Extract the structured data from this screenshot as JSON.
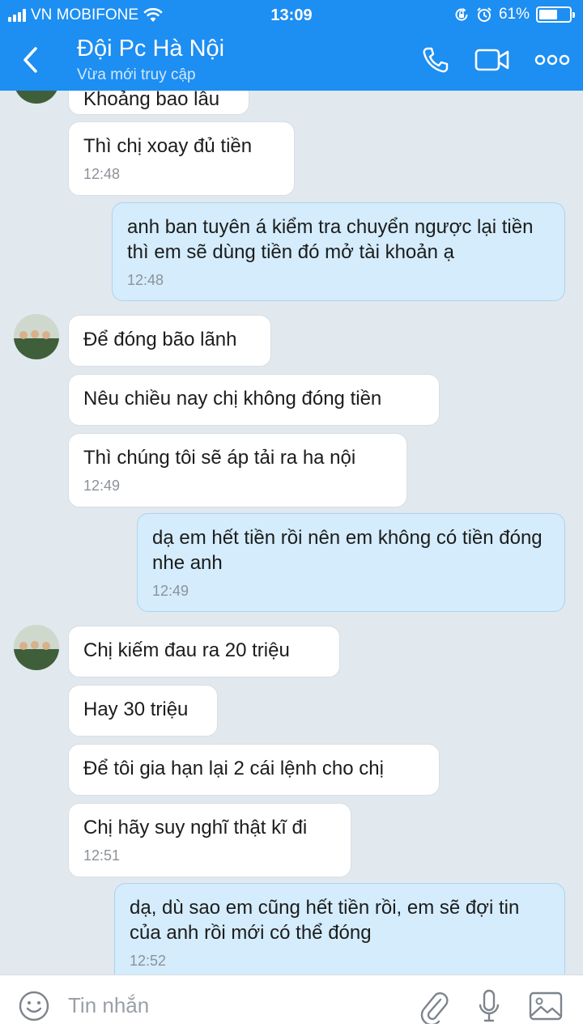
{
  "status_bar": {
    "carrier": "VN MOBIFONE",
    "time": "13:09",
    "battery": "61%",
    "battery_level": 0.61
  },
  "header": {
    "title": "Đội  Pc Hà Nội",
    "subtitle": "Vừa mới truy cập",
    "icons": [
      "back-arrow-icon",
      "phone-icon",
      "video-call-icon",
      "more-icon"
    ],
    "color": "#1d8ef2"
  },
  "messages": [
    {
      "side": "in",
      "text": "Khoảng bao lâu",
      "time": ""
    },
    {
      "side": "in",
      "text": "Thì chị xoay đủ tiền",
      "time": "12:48"
    },
    {
      "side": "out",
      "text": "anh ban tuyên á kiểm tra chuyển ngược lại tiền thì em sẽ dùng tiền đó mở tài khoản ạ",
      "time": "12:48"
    },
    {
      "side": "in",
      "text": "Để đóng bão lãnh",
      "time": ""
    },
    {
      "side": "in",
      "text": "Nêu chiều nay chị không đóng tiền",
      "time": ""
    },
    {
      "side": "in",
      "text": "Thì chúng tôi sẽ áp tải ra ha nội",
      "time": "12:49"
    },
    {
      "side": "out",
      "text": "dạ em hết tiền rồi nên em không có tiền đóng nhe anh",
      "time": "12:49"
    },
    {
      "side": "in",
      "text": "Chị kiếm đau ra 20 triệu",
      "time": ""
    },
    {
      "side": "in",
      "text": "Hay 30 triệu",
      "time": ""
    },
    {
      "side": "in",
      "text": "Để tôi gia hạn lại 2 cái lệnh cho chị",
      "time": ""
    },
    {
      "side": "in",
      "text": "Chị hãy suy nghĩ thật kĩ đi",
      "time": "12:51"
    },
    {
      "side": "out",
      "text": "dạ, dù sao em cũng hết tiền rồi, em sẽ đợi tin của anh rồi mới có thể đóng",
      "time": "12:52"
    }
  ],
  "input_bar": {
    "placeholder": "Tin nhắn",
    "icons": [
      "emoji-icon",
      "attachment-icon",
      "microphone-icon",
      "image-icon"
    ]
  }
}
